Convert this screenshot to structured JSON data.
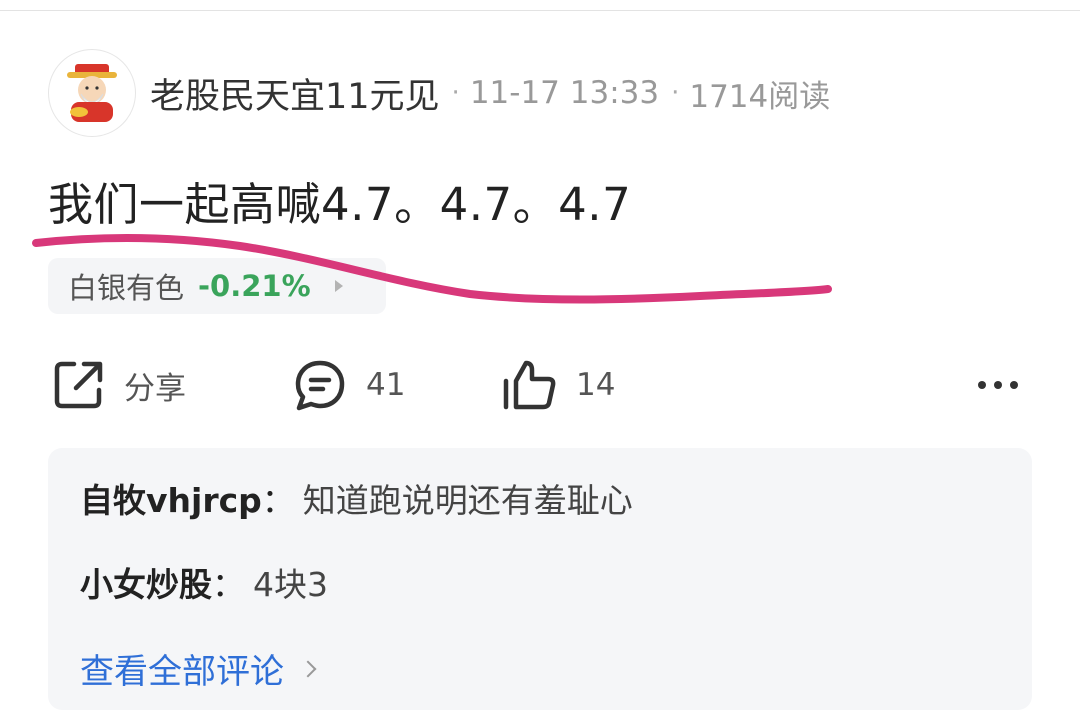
{
  "post": {
    "author": "老股民天宜11元见",
    "separator": "·",
    "datetime": "11-17 13:33",
    "reads": "1714阅读",
    "text": "我们一起高喊4.7。4.7。4.7"
  },
  "stock": {
    "name": "白银有色",
    "change": "-0.21%",
    "change_color": "#3aa45b"
  },
  "actions": {
    "share_label": "分享",
    "comment_count": "41",
    "like_count": "14"
  },
  "comments": [
    {
      "author": "自牧vhjrcp",
      "colon": "：",
      "text": "知道跑说明还有羞耻心"
    },
    {
      "author": "小女炒股",
      "colon": "：",
      "text": "4块3"
    }
  ],
  "view_all_label": "查看全部评论",
  "colors": {
    "accent_blue": "#2f6fd7",
    "annotation_stroke": "#d8387a",
    "positive_green": "#3aa45b"
  }
}
